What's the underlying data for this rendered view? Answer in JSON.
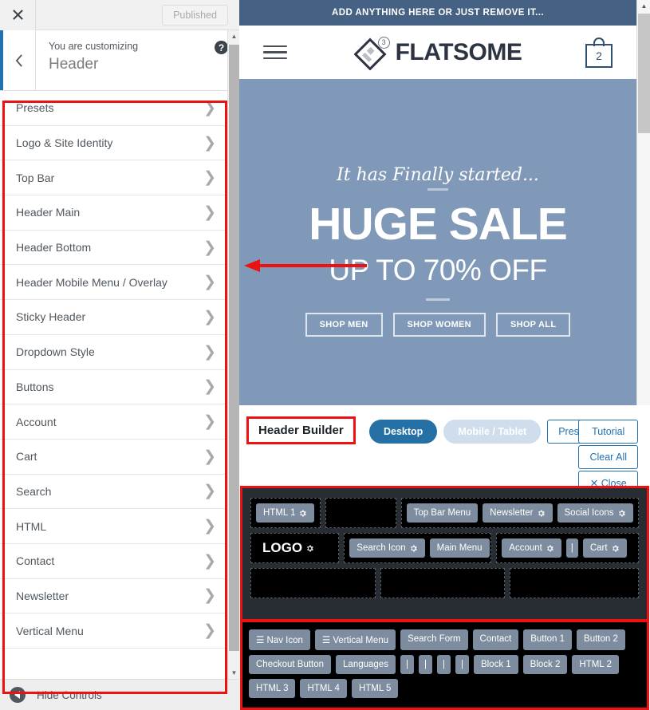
{
  "customizer": {
    "close_icon": "close-icon",
    "published_label": "Published",
    "back_icon": "chevron-left-icon",
    "subtitle": "You are customizing",
    "title": "Header",
    "help_label": "?",
    "hide_controls_label": "Hide Controls",
    "items": [
      {
        "label": "Presets"
      },
      {
        "label": "Logo & Site Identity"
      },
      {
        "label": "Top Bar"
      },
      {
        "label": "Header Main"
      },
      {
        "label": "Header Bottom"
      },
      {
        "label": "Header Mobile Menu / Overlay"
      },
      {
        "label": "Sticky Header"
      },
      {
        "label": "Dropdown Style"
      },
      {
        "label": "Buttons"
      },
      {
        "label": "Account"
      },
      {
        "label": "Cart"
      },
      {
        "label": "Search"
      },
      {
        "label": "HTML"
      },
      {
        "label": "Contact"
      },
      {
        "label": "Newsletter"
      },
      {
        "label": "Vertical Menu"
      }
    ]
  },
  "preview": {
    "topbar_text": "ADD ANYTHING HERE OR JUST REMOVE IT...",
    "logo_text": "FLATSOME",
    "logo_badge": "3",
    "cart_count": "2",
    "hero": {
      "script_text": "It has Finally started...",
      "title": "HUGE SALE",
      "subtitle": "UP TO 70% OFF",
      "buttons": [
        "SHOP MEN",
        "SHOP WOMEN",
        "SHOP ALL"
      ]
    }
  },
  "header_builder": {
    "title": "Header Builder",
    "device_tabs": [
      {
        "label": "Desktop",
        "active": true
      },
      {
        "label": "Mobile / Tablet",
        "active": false
      }
    ],
    "presets_label": "Presets",
    "tutorial_label": "Tutorial",
    "clear_all_label": "Clear All",
    "close_label": "✕ Close",
    "grid": [
      {
        "cells": [
          {
            "chips": [
              {
                "label": "HTML 1",
                "gear": true
              }
            ]
          },
          {
            "chips": []
          },
          {
            "chips": [
              {
                "label": "Top Bar Menu",
                "gear": false
              },
              {
                "label": "Newsletter",
                "gear": true
              },
              {
                "label": "Social Icons",
                "gear": true
              }
            ]
          }
        ]
      },
      {
        "cells": [
          {
            "chips": [
              {
                "label": "LOGO",
                "gear": true,
                "logo": true
              }
            ]
          },
          {
            "chips": [
              {
                "label": "Search Icon",
                "gear": true
              },
              {
                "label": "Main Menu",
                "gear": false
              }
            ]
          },
          {
            "chips": [
              {
                "label": "Account",
                "gear": true
              },
              {
                "label": "|",
                "gear": false,
                "sep": true
              },
              {
                "label": "Cart",
                "gear": true
              }
            ]
          }
        ]
      },
      {
        "cells": [
          {
            "chips": []
          },
          {
            "chips": []
          },
          {
            "chips": []
          }
        ]
      }
    ],
    "palette": [
      [
        {
          "label": "☰ Nav Icon"
        },
        {
          "label": "☰ Vertical Menu"
        },
        {
          "label": "Search Form"
        },
        {
          "label": "Contact"
        },
        {
          "label": "Button 1"
        },
        {
          "label": "Button 2"
        }
      ],
      [
        {
          "label": "Checkout Button"
        },
        {
          "label": "Languages"
        },
        {
          "label": "|",
          "narrow": true
        },
        {
          "label": "|",
          "narrow": true
        },
        {
          "label": "|",
          "narrow": true
        },
        {
          "label": "|",
          "narrow": true
        },
        {
          "label": "Block 1"
        },
        {
          "label": "Block 2"
        },
        {
          "label": "HTML 2"
        }
      ],
      [
        {
          "label": "HTML 3"
        },
        {
          "label": "HTML 4"
        },
        {
          "label": "HTML 5"
        }
      ]
    ]
  },
  "annotations": {
    "arrow_color": "#ee1111",
    "box_color": "#ee1111"
  },
  "colors": {
    "topbar_blue": "#456184",
    "hero_blue": "#8199b8",
    "builder_dark": "#282d33",
    "chip_blue": "#7d8c9e",
    "accent_blue": "#2271b1"
  }
}
